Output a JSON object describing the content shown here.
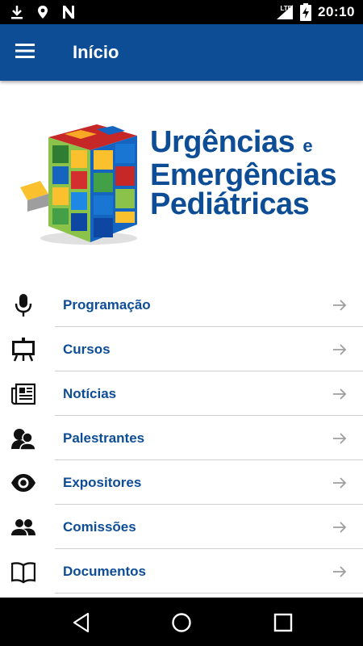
{
  "status_bar": {
    "network": "LTE",
    "time": "20:10",
    "left_icons": [
      "download-icon",
      "location-icon",
      "n-icon"
    ]
  },
  "app_bar": {
    "title": "Início",
    "menu_icon": "hamburger-icon"
  },
  "logo": {
    "line1": "Urgências",
    "line1_small": "e",
    "line2": "Emergências",
    "line3": "Pediátricas"
  },
  "menu_items": [
    {
      "label": "Programação",
      "icon": "microphone-icon"
    },
    {
      "label": "Cursos",
      "icon": "presentation-board-icon"
    },
    {
      "label": "Notícias",
      "icon": "newspaper-icon"
    },
    {
      "label": "Palestrantes",
      "icon": "speakers-icon"
    },
    {
      "label": "Expositores",
      "icon": "eye-icon"
    },
    {
      "label": "Comissões",
      "icon": "people-icon"
    },
    {
      "label": "Documentos",
      "icon": "book-icon"
    }
  ],
  "colors": {
    "primary": "#0d4d96",
    "divider": "#d0d0d0",
    "arrow": "#9e9e9e",
    "status_bar": "#000000"
  },
  "nav_bar": {
    "buttons": [
      "back-icon",
      "home-icon",
      "recents-icon"
    ]
  }
}
